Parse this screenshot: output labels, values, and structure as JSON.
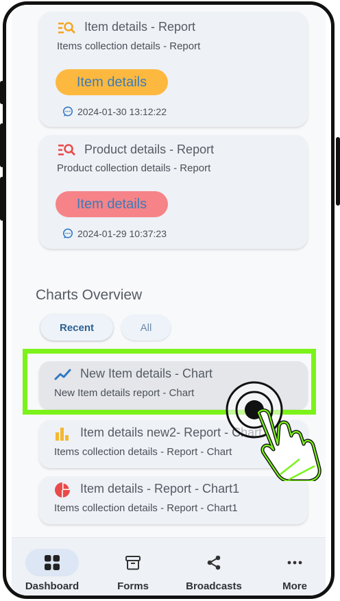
{
  "reports": [
    {
      "title": "Item details - Report",
      "subtitle": "Items collection details  - Report",
      "button": "Item details",
      "timestamp": "2024-01-30 13:12:22",
      "button_color": "#fdb93f"
    },
    {
      "title": "Product details - Report",
      "subtitle": "Product collection details  - Report",
      "button": "Item details",
      "timestamp": "2024-01-29 10:37:23",
      "button_color": "#f58388"
    }
  ],
  "charts_overview": {
    "title": "Charts Overview",
    "tabs": [
      "Recent",
      "All"
    ],
    "active_tab": "Recent",
    "items": [
      {
        "title": "New Item details - Chart",
        "subtitle": "New Item details report - Chart",
        "icon": "line-chart-icon",
        "highlighted": true
      },
      {
        "title": "Item details new2- Report - Chart",
        "subtitle": "Items collection details  - Report - Chart",
        "icon": "bar-chart-icon"
      },
      {
        "title": "Item details - Report - Chart1",
        "subtitle": "Items collection details  - Report - Chart1",
        "icon": "pie-chart-icon"
      }
    ]
  },
  "bottom_nav": [
    {
      "label": "Dashboard",
      "icon": "dashboard-grid-icon",
      "active": true
    },
    {
      "label": "Forms",
      "icon": "archive-box-icon"
    },
    {
      "label": "Broadcasts",
      "icon": "share-icon"
    },
    {
      "label": "More",
      "icon": "more-dots-icon"
    }
  ],
  "colors": {
    "highlight": "#7cf21a",
    "accent_blue": "#2f78c4",
    "report_icon_orange": "#f5a623",
    "report_icon_red": "#e94b4b"
  }
}
